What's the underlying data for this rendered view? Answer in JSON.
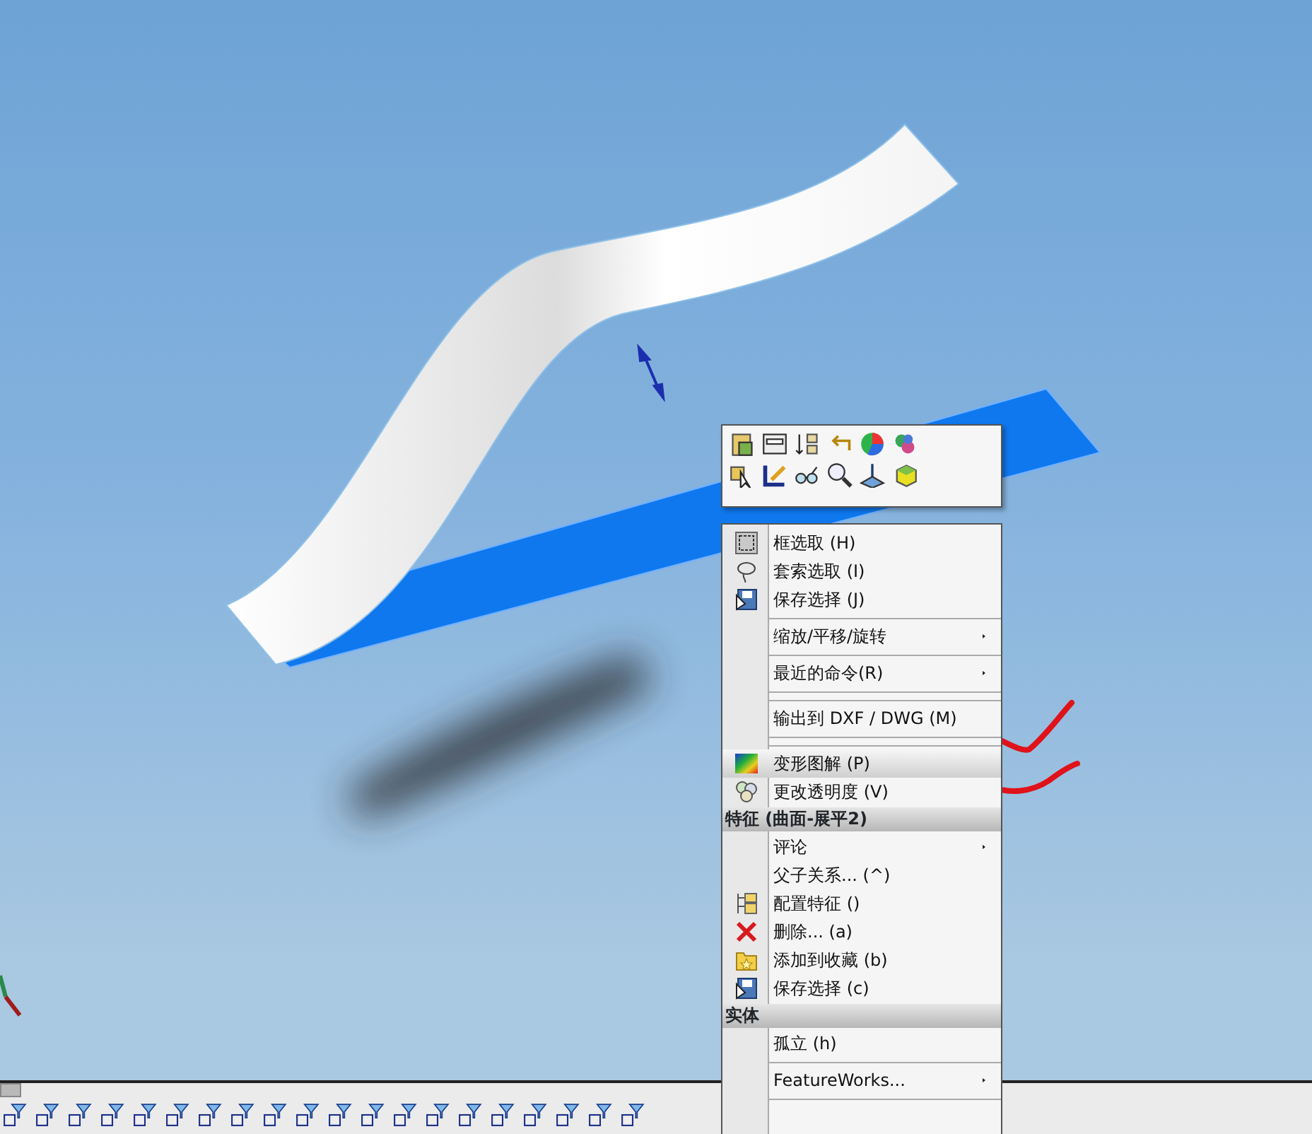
{
  "menu": {
    "items": [
      {
        "kind": "item",
        "label": "框选取 (H)",
        "submenu": false,
        "selected": false
      },
      {
        "kind": "item",
        "label": "套索选取 (I)",
        "submenu": false,
        "selected": false
      },
      {
        "kind": "item",
        "label": "保存选择 (J)",
        "submenu": false,
        "selected": false
      },
      {
        "kind": "separator"
      },
      {
        "kind": "item",
        "label": "缩放/平移/旋转",
        "submenu": true,
        "selected": false
      },
      {
        "kind": "separator"
      },
      {
        "kind": "item",
        "label": "最近的命令(R)",
        "submenu": true,
        "selected": false
      },
      {
        "kind": "separator"
      },
      {
        "kind": "separator"
      },
      {
        "kind": "item",
        "label": "输出到 DXF / DWG (M)",
        "submenu": false,
        "selected": false
      },
      {
        "kind": "separator"
      },
      {
        "kind": "separator"
      },
      {
        "kind": "item",
        "label": "变形图解 (P)",
        "submenu": false,
        "selected": true
      },
      {
        "kind": "item",
        "label": "更改透明度 (V)",
        "submenu": false,
        "selected": false
      },
      {
        "kind": "header",
        "label": "特征 (曲面-展平2)"
      },
      {
        "kind": "item",
        "label": "评论",
        "submenu": true,
        "selected": false
      },
      {
        "kind": "item",
        "label": "父子关系... (^)",
        "submenu": false,
        "selected": false
      },
      {
        "kind": "item",
        "label": "配置特征 ()",
        "submenu": false,
        "selected": false
      },
      {
        "kind": "item",
        "label": "删除... (a)",
        "submenu": false,
        "selected": false
      },
      {
        "kind": "item",
        "label": "添加到收藏 (b)",
        "submenu": false,
        "selected": false
      },
      {
        "kind": "item",
        "label": "保存选择 (c)",
        "submenu": false,
        "selected": false
      },
      {
        "kind": "header",
        "label": "实体"
      },
      {
        "kind": "item",
        "label": "孤立 (h)",
        "submenu": false,
        "selected": false
      },
      {
        "kind": "separator"
      },
      {
        "kind": "item",
        "label": "FeatureWorks...",
        "submenu": true,
        "selected": false
      },
      {
        "kind": "separator"
      }
    ]
  }
}
